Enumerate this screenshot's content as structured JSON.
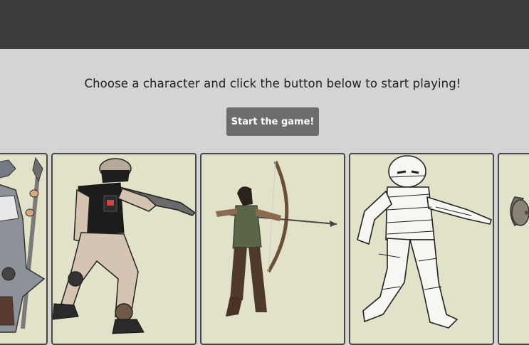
{
  "page": {
    "instruction": "Choose a character and click the button below to start playing!",
    "start_button_label": "Start the game!"
  },
  "characters": [
    {
      "icon": "wizard-icon"
    },
    {
      "icon": "soldier-icon"
    },
    {
      "icon": "archer-icon"
    },
    {
      "icon": "mummy-icon"
    },
    {
      "icon": "axe-warrior-icon"
    }
  ],
  "colors": {
    "topbar": "#3d3c3e",
    "background": "#d4d4d4",
    "button": "#6d6d6d",
    "card": "#e2e2c9",
    "card_border": "#474747"
  }
}
